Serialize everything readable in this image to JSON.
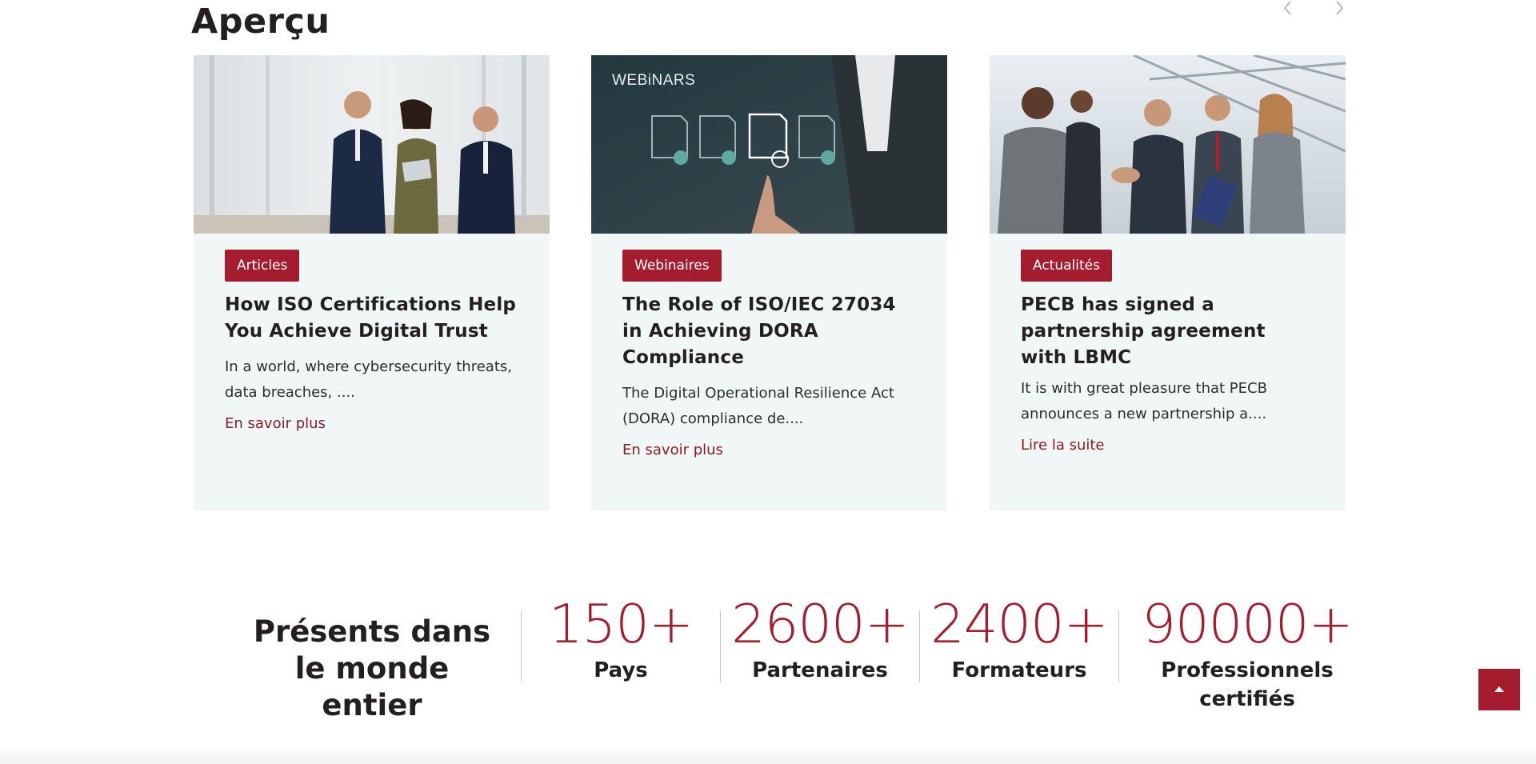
{
  "section": {
    "title": "Aperçu"
  },
  "carousel": {
    "prev_icon": "chevron-left-icon",
    "next_icon": "chevron-right-icon"
  },
  "cards": [
    {
      "tag": "Articles",
      "title": "How ISO Certifications Help You Achieve Digital Trust",
      "excerpt": "In a world, where cybersecurity threats, data breaches, ....",
      "link": "En savoir plus"
    },
    {
      "tag": "Webinaires",
      "image_text": "WEBiNARS",
      "title": "The Role of ISO/IEC 27034 in Achieving DORA Compliance",
      "excerpt": "The Digital Operational Resilience Act (DORA) compliance de....",
      "link": "En savoir plus"
    },
    {
      "tag": "Actualités",
      "title": "PECB has signed a partnership agreement with LBMC",
      "excerpt": "It is with great pleasure that PECB announces a new partnership a....",
      "link": "Lire la suite"
    }
  ],
  "stats": {
    "heading": "Présents dans le monde entier",
    "items": [
      {
        "number": "150+",
        "label": "Pays"
      },
      {
        "number": "2600+",
        "label": "Partenaires"
      },
      {
        "number": "2400+",
        "label": "Formateurs"
      },
      {
        "number": "90000+",
        "label": "Professionnels certifiés"
      }
    ]
  },
  "colors": {
    "accent": "#a31d2f",
    "link": "#8b1c24",
    "card_bg": "#f1f6f7",
    "text": "#231f20"
  },
  "back_to_top": {
    "icon": "chevron-up-icon"
  }
}
